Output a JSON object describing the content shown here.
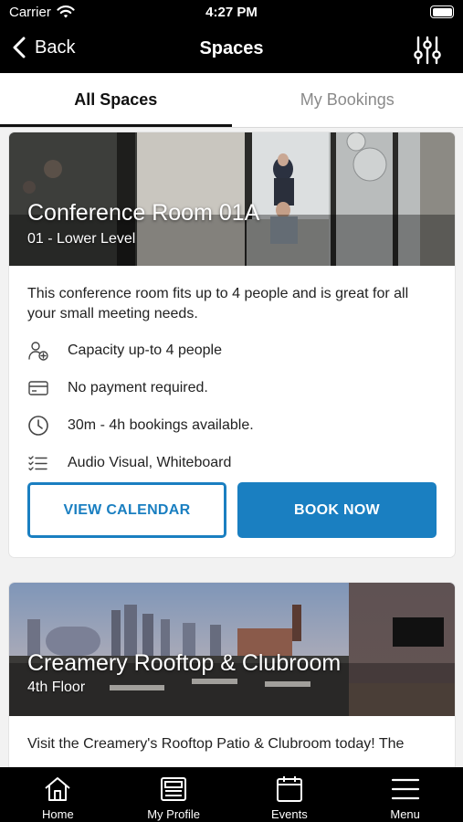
{
  "status_bar": {
    "carrier": "Carrier",
    "time": "4:27 PM"
  },
  "nav": {
    "back_label": "Back",
    "title": "Spaces"
  },
  "tabs": [
    {
      "label": "All Spaces",
      "active": true
    },
    {
      "label": "My Bookings",
      "active": false
    }
  ],
  "spaces": [
    {
      "name": "Conference Room 01A",
      "floor": "01 - Lower Level",
      "description": "This conference room fits up to 4 people and is great for all your small meeting needs.",
      "features": [
        {
          "icon": "person-add-icon",
          "label": "Capacity up-to 4 people"
        },
        {
          "icon": "credit-card-icon",
          "label": "No payment required."
        },
        {
          "icon": "clock-icon",
          "label": "30m - 4h bookings available."
        },
        {
          "icon": "checklist-icon",
          "label": "Audio Visual, Whiteboard"
        }
      ],
      "view_calendar_label": "VIEW CALENDAR",
      "book_now_label": "BOOK NOW"
    },
    {
      "name": "Creamery Rooftop & Clubroom",
      "floor": "4th Floor",
      "description": "Visit the Creamery's Rooftop Patio & Clubroom today! The"
    }
  ],
  "bottom_tabs": [
    {
      "icon": "home-icon",
      "label": "Home"
    },
    {
      "icon": "profile-card-icon",
      "label": "My Profile"
    },
    {
      "icon": "calendar-icon",
      "label": "Events"
    },
    {
      "icon": "hamburger-menu-icon",
      "label": "Menu"
    }
  ],
  "colors": {
    "accent": "#1a7fc1",
    "bar_bg": "#000000"
  }
}
